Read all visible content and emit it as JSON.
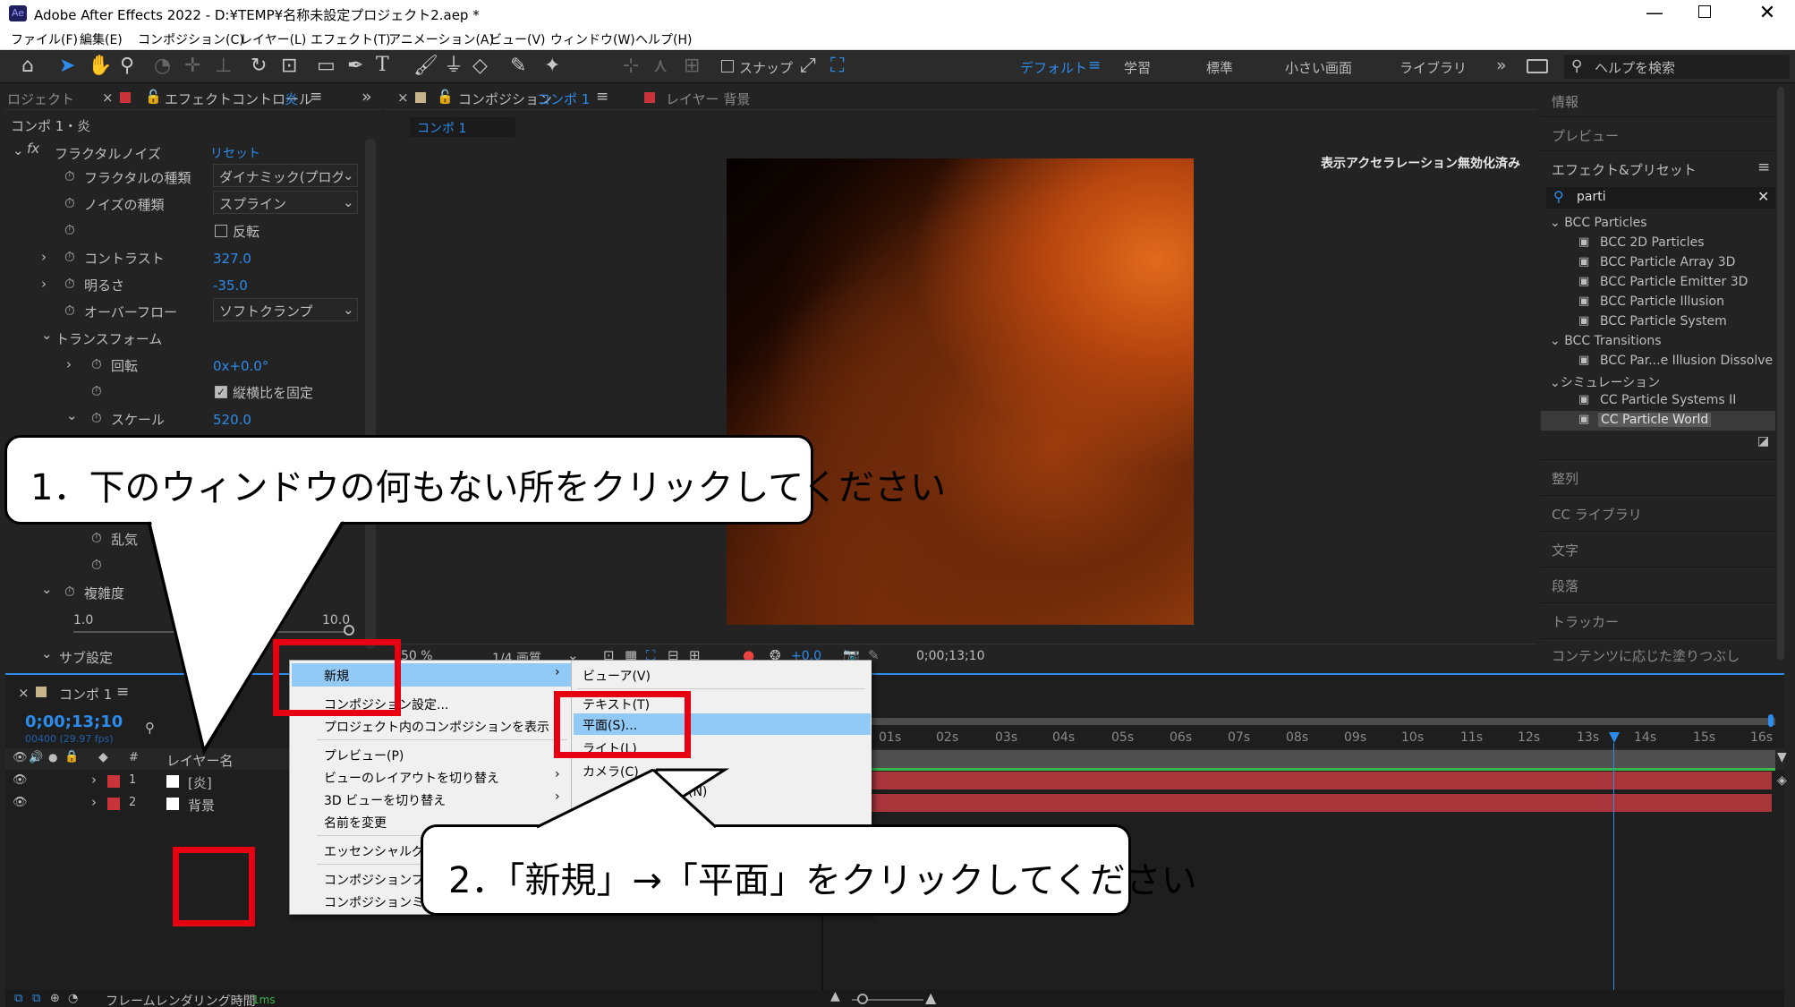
{
  "window": {
    "title": "Adobe After Effects 2022 - D:¥TEMP¥名称未設定プロジェクト2.aep *",
    "app_icon": "Ae"
  },
  "menubar": [
    "ファイル(F)",
    "編集(E)",
    "コンポジション(C)",
    "レイヤー(L)",
    "エフェクト(T)",
    "アニメーション(A)",
    "ビュー(V)",
    "ウィンドウ(W)",
    "ヘルプ(H)"
  ],
  "toolbar": {
    "snap_label": "スナップ",
    "workspaces": [
      "デフォルト",
      "学習",
      "標準",
      "小さい画面",
      "ライブラリ"
    ],
    "search_placeholder": "ヘルプを検索"
  },
  "effect_panel": {
    "project_tab": "ロジェクト",
    "tab_label": "エフェクトコントロール",
    "tab_accent": "炎",
    "subtitle": "コンポ 1・炎",
    "effect_name": "フラクタルノイズ",
    "reset": "リセット",
    "params": [
      {
        "label": "フラクタルの種類",
        "value": "ダイナミック(プログレ"
      },
      {
        "label": "ノイズの種類",
        "value": "スプライン"
      },
      {
        "label": "",
        "value": "反転"
      },
      {
        "label": "コントラスト",
        "value": "327.0"
      },
      {
        "label": "明るさ",
        "value": "-35.0"
      },
      {
        "label": "オーバーフロー",
        "value": "ソフトクランプ"
      },
      {
        "label": "トランスフォーム",
        "value": ""
      },
      {
        "label": "回転",
        "value": "0x+0.0°"
      },
      {
        "label": "",
        "value": "縦横比を固定"
      },
      {
        "label": "スケール",
        "value": "520.0"
      },
      {
        "label": "乱気",
        "value": ""
      },
      {
        "label": "複雑度",
        "value": ""
      },
      {
        "label": "サブ設定",
        "value": ""
      }
    ],
    "slider_min": "1.0",
    "slider_max": "10.0"
  },
  "comp_panel": {
    "tab_label": "コンポジション",
    "tab_accent": "コンポ 1",
    "layer_tab": "レイヤー 背景",
    "comp_chip": "コンポ 1",
    "accel_notice": "表示アクセラレーション無効化済み",
    "zoom": "50 %",
    "resolution": "1/4 画質",
    "exposure": "+0.0",
    "timecode": "0;00;13;10"
  },
  "right_panel": {
    "items_top": [
      "情報",
      "プレビュー"
    ],
    "effects_title": "エフェクト&プリセット",
    "search_value": "parti",
    "tree": [
      {
        "type": "folder",
        "label": "BCC Particles"
      },
      {
        "type": "item",
        "label": "BCC 2D Particles"
      },
      {
        "type": "item",
        "label": "BCC Particle Array 3D"
      },
      {
        "type": "item",
        "label": "BCC Particle Emitter 3D"
      },
      {
        "type": "item",
        "label": "BCC Particle Illusion"
      },
      {
        "type": "item",
        "label": "BCC Particle System"
      },
      {
        "type": "folder",
        "label": "BCC Transitions"
      },
      {
        "type": "item",
        "label": "BCC Par...e Illusion Dissolve"
      },
      {
        "type": "folder",
        "label": "シミュレーション"
      },
      {
        "type": "item",
        "label": "CC Particle Systems II"
      },
      {
        "type": "item",
        "label": "CC Particle World",
        "selected": true
      }
    ],
    "items_bottom": [
      "整列",
      "CC ライブラリ",
      "文字",
      "段落",
      "トラッカー",
      "コンテンツに応じた塗りつぶし"
    ]
  },
  "timeline": {
    "tab_label": "コンポ 1",
    "timecode": "0;00;13;10",
    "fps": "00400 (29.97 fps)",
    "col_layer_name": "レイヤー名",
    "col_hash": "#",
    "layers": [
      {
        "num": "1",
        "name": "[炎]"
      },
      {
        "num": "2",
        "name": "背景"
      }
    ],
    "ruler": [
      "01s",
      "02s",
      "03s",
      "04s",
      "05s",
      "06s",
      "07s",
      "08s",
      "09s",
      "10s",
      "11s",
      "12s",
      "13s",
      "14s",
      "15s",
      "16s"
    ],
    "footer_label": "フレームレンダリング時間",
    "footer_value": "1ms"
  },
  "context_menu": {
    "items": [
      "新規",
      "コンポジション設定...",
      "プロジェクト内のコンポジションを表示",
      "プレビュー(P)",
      "ビューのレイアウトを切り替え",
      "3D ビューを切り替え",
      "名前を変更",
      "エッセンシャルグラ",
      "コンポジションフロー",
      "コンポジションミニ"
    ],
    "submenu": [
      "ビューア(V)",
      "テキスト(T)",
      "平面(S)...",
      "ライト(L)",
      "カメラ(C)",
      "(N)"
    ]
  },
  "callouts": {
    "first": "1．下のウィンドウの何もない所をクリックしてください",
    "second": "2．「新規」→「平面」をクリックしてください"
  },
  "colors": {
    "accent_blue": "#2d8ceb",
    "highlight_red": "#e60012",
    "menu_highlight": "#91c9f7",
    "layer_bar": "#a8363b",
    "timeline_green": "#39b54a"
  }
}
